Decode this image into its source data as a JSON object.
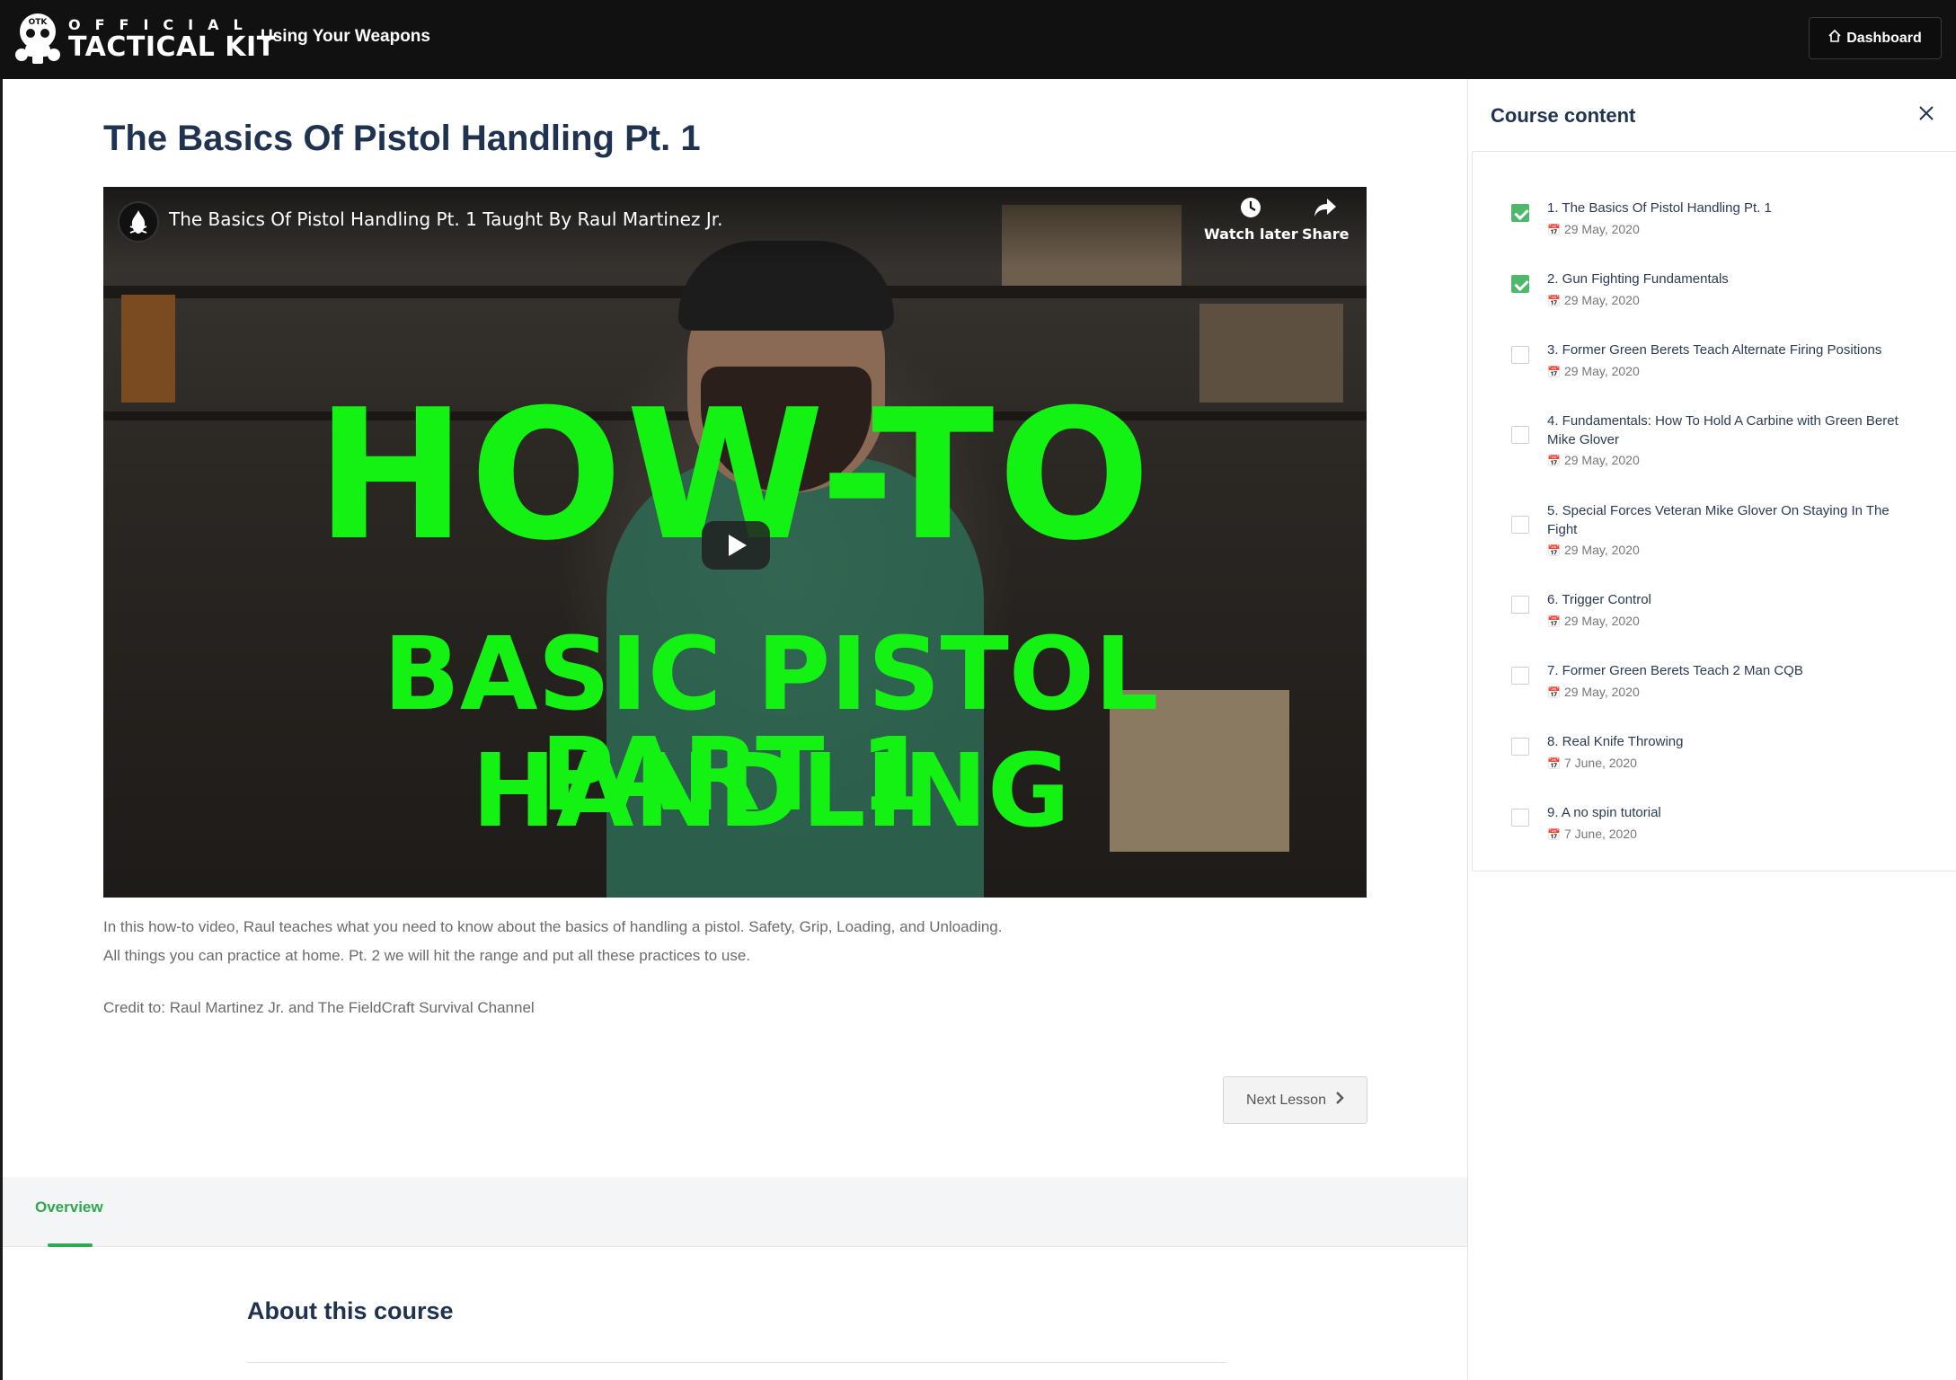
{
  "header": {
    "brand_top": "OFFICIAL",
    "brand_main": "TACTICAL KIT",
    "course_name": "Using Your Weapons",
    "dashboard_label": "Dashboard",
    "logo_badge": "OTK"
  },
  "lesson": {
    "title": "The Basics Of Pistol Handling Pt. 1",
    "video": {
      "title": "The Basics Of Pistol Handling Pt. 1 Taught By Raul Martinez Jr.",
      "watch_later": "Watch later",
      "share": "Share",
      "thumb_line1": "HOW-TO",
      "thumb_line2": "BASIC PISTOL HANDLING",
      "thumb_line3": "PART 1"
    },
    "description_line1": "In this how-to video, Raul teaches what you need to know about the basics of handling a pistol. Safety, Grip, Loading, and Unloading.",
    "description_line2": "All things you can practice at home. Pt. 2 we will hit the range and put all these practices to use.",
    "credit": "Credit to: Raul Martinez Jr. and The FieldCraft Survival Channel",
    "next_label": "Next Lesson"
  },
  "tabs": {
    "overview": "Overview"
  },
  "about": {
    "title": "About this course"
  },
  "sidebar": {
    "title": "Course content",
    "items": [
      {
        "label": "1. The Basics Of Pistol Handling Pt. 1",
        "date": "29 May, 2020",
        "done": true
      },
      {
        "label": "2. Gun Fighting Fundamentals",
        "date": "29 May, 2020",
        "done": true
      },
      {
        "label": "3. Former Green Berets Teach Alternate Firing Positions",
        "date": "29 May, 2020",
        "done": false
      },
      {
        "label": "4. Fundamentals: How To Hold A Carbine with Green Beret Mike Glover",
        "date": "29 May, 2020",
        "done": false
      },
      {
        "label": "5. Special Forces Veteran Mike Glover On Staying In The Fight",
        "date": "29 May, 2020",
        "done": false
      },
      {
        "label": "6. Trigger Control",
        "date": "29 May, 2020",
        "done": false
      },
      {
        "label": "7. Former Green Berets Teach 2 Man CQB",
        "date": "29 May, 2020",
        "done": false
      },
      {
        "label": "8. Real Knife Throwing",
        "date": "7 June, 2020",
        "done": false
      },
      {
        "label": "9. A no spin tutorial",
        "date": "7 June, 2020",
        "done": false
      }
    ]
  },
  "colors": {
    "accent_green": "#2fa84f",
    "check_green": "#4fb86c",
    "title_navy": "#1f3350",
    "header_bg": "#111111",
    "thumb_text": "#14f214"
  }
}
